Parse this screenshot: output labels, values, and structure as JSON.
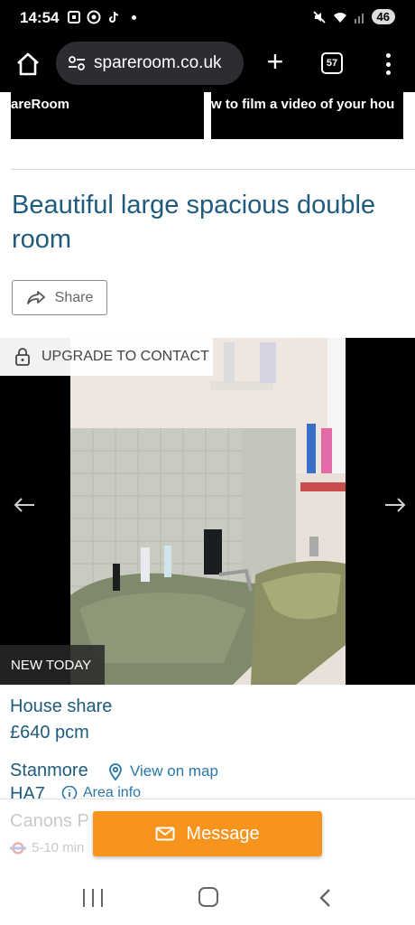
{
  "status_bar": {
    "time": "14:54",
    "battery": "46",
    "icons": [
      "screenshot-icon",
      "chrome-icon",
      "tiktok-icon",
      "notification-dot",
      "mute-icon",
      "wifi-icon",
      "signal-icon",
      "battery-icon"
    ]
  },
  "browser": {
    "url": "spareroom.co.uk",
    "tab_count": "57"
  },
  "video_thumbs": [
    {
      "caption": "areRoom"
    },
    {
      "caption": "w to film a video of your hou"
    }
  ],
  "listing": {
    "title": "Beautiful large spacious double room",
    "share_label": "Share",
    "upgrade_label": "UPGRADE TO CONTACT",
    "badge": "NEW TODAY",
    "room_type": "House share",
    "price": "£640 pcm",
    "area": "Stanmore",
    "view_map_label": "View on map",
    "postcode": "HA7",
    "area_info_label": "Area info",
    "station": "Canons P",
    "travel_time": "5-10 min"
  },
  "actions": {
    "message_label": "Message"
  },
  "colors": {
    "brand_blue": "#1f5b7e",
    "link_blue": "#2a77a8",
    "accent_orange": "#f7941d"
  }
}
